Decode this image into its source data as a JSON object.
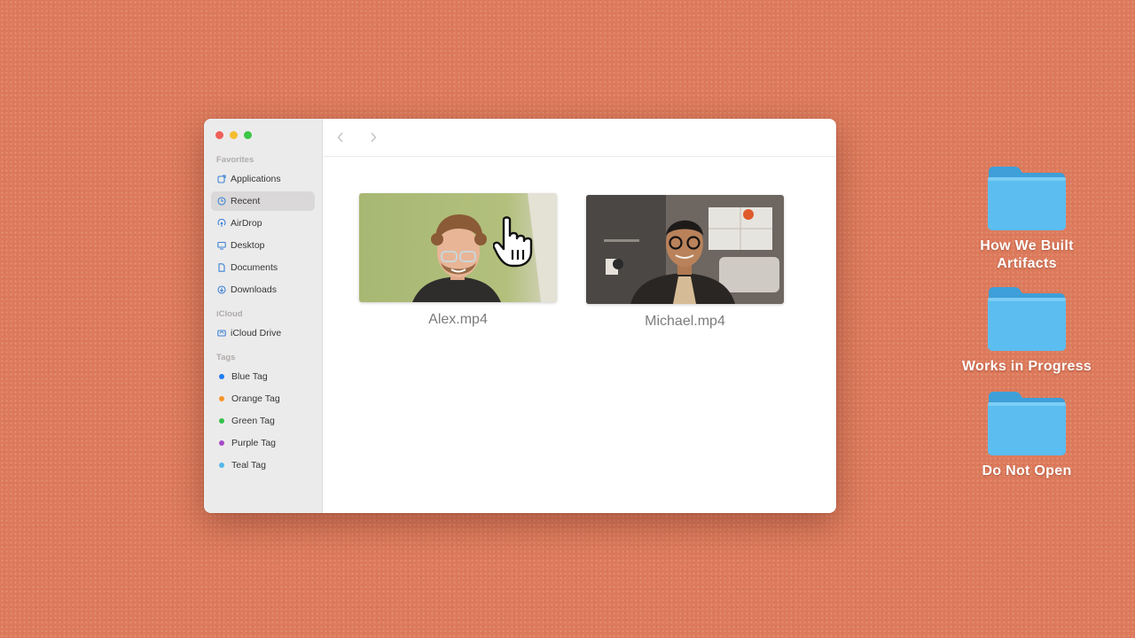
{
  "finder": {
    "sidebar": {
      "favorites_heading": "Favorites",
      "favorites": [
        {
          "label": "Applications",
          "icon": "applications-icon"
        },
        {
          "label": "Recent",
          "icon": "clock-icon",
          "selected": true
        },
        {
          "label": "AirDrop",
          "icon": "airdrop-icon"
        },
        {
          "label": "Desktop",
          "icon": "desktop-icon"
        },
        {
          "label": "Documents",
          "icon": "document-icon"
        },
        {
          "label": "Downloads",
          "icon": "download-icon"
        }
      ],
      "icloud_heading": "iCloud",
      "icloud": [
        {
          "label": "iCloud Drive",
          "icon": "cloud-icon"
        }
      ],
      "tags_heading": "Tags",
      "tags": [
        {
          "label": "Blue Tag",
          "color": "#1f7df0"
        },
        {
          "label": "Orange Tag",
          "color": "#f5952b"
        },
        {
          "label": "Green Tag",
          "color": "#34c24b"
        },
        {
          "label": "Purple Tag",
          "color": "#a74bc9"
        },
        {
          "label": "Teal Tag",
          "color": "#54b8e8"
        }
      ]
    },
    "files": [
      {
        "name": "Alex.mp4"
      },
      {
        "name": "Michael.mp4"
      }
    ]
  },
  "desktop": {
    "folders": [
      {
        "label": "How We Built Artifacts"
      },
      {
        "label": "Works in Progress"
      },
      {
        "label": "Do Not Open"
      }
    ]
  }
}
